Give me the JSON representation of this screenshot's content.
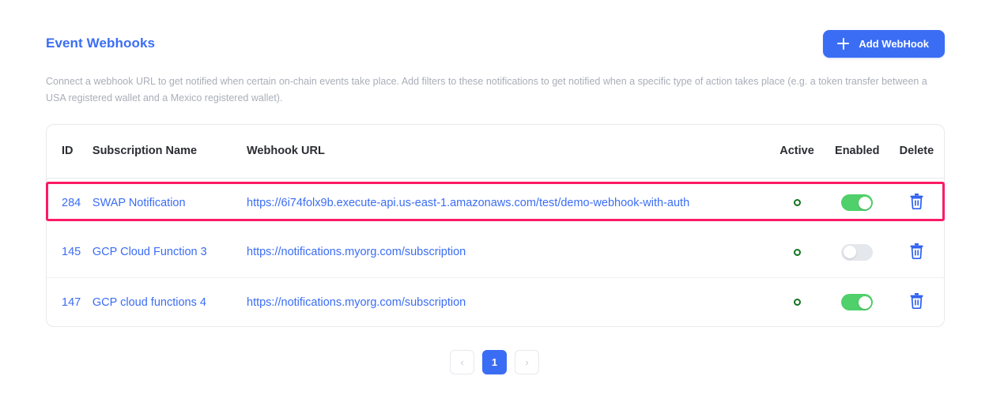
{
  "header": {
    "title": "Event Webhooks",
    "add_button_label": "Add WebHook",
    "add_button_icon": "plus-icon",
    "accent_color": "#3B6DF4"
  },
  "description": "Connect a webhook URL to get notified when certain on-chain events take place. Add filters to these notifications to get notified when a specific type of action takes place (e.g. a token transfer between a USA registered wallet and a Mexico registered wallet).",
  "table": {
    "columns": [
      "ID",
      "Subscription Name",
      "Webhook URL",
      "Active",
      "Enabled",
      "Delete"
    ],
    "rows": [
      {
        "id": "284",
        "name": "SWAP Notification",
        "url": "https://6i74folx9b.execute-api.us-east-1.amazonaws.com/test/demo-webhook-with-auth",
        "active": true,
        "enabled": true,
        "delete_icon": "trash-icon",
        "highlighted": true
      },
      {
        "id": "145",
        "name": "GCP Cloud Function 3",
        "url": "https://notifications.myorg.com/subscription",
        "active": true,
        "enabled": false,
        "delete_icon": "trash-icon",
        "highlighted": false
      },
      {
        "id": "147",
        "name": "GCP cloud functions 4",
        "url": "https://notifications.myorg.com/subscription",
        "active": true,
        "enabled": true,
        "delete_icon": "trash-icon",
        "highlighted": false
      }
    ]
  },
  "pagination": {
    "prev_label": "‹",
    "next_label": "›",
    "pages": [
      "1"
    ],
    "current_page": "1"
  },
  "colors": {
    "highlight_border": "#FB1B66",
    "toggle_on": "#4FD06A",
    "toggle_off": "#E4E7EC",
    "active_dot": "#12741F",
    "link": "#3B6DF4",
    "muted_text": "#A9AEB8"
  }
}
